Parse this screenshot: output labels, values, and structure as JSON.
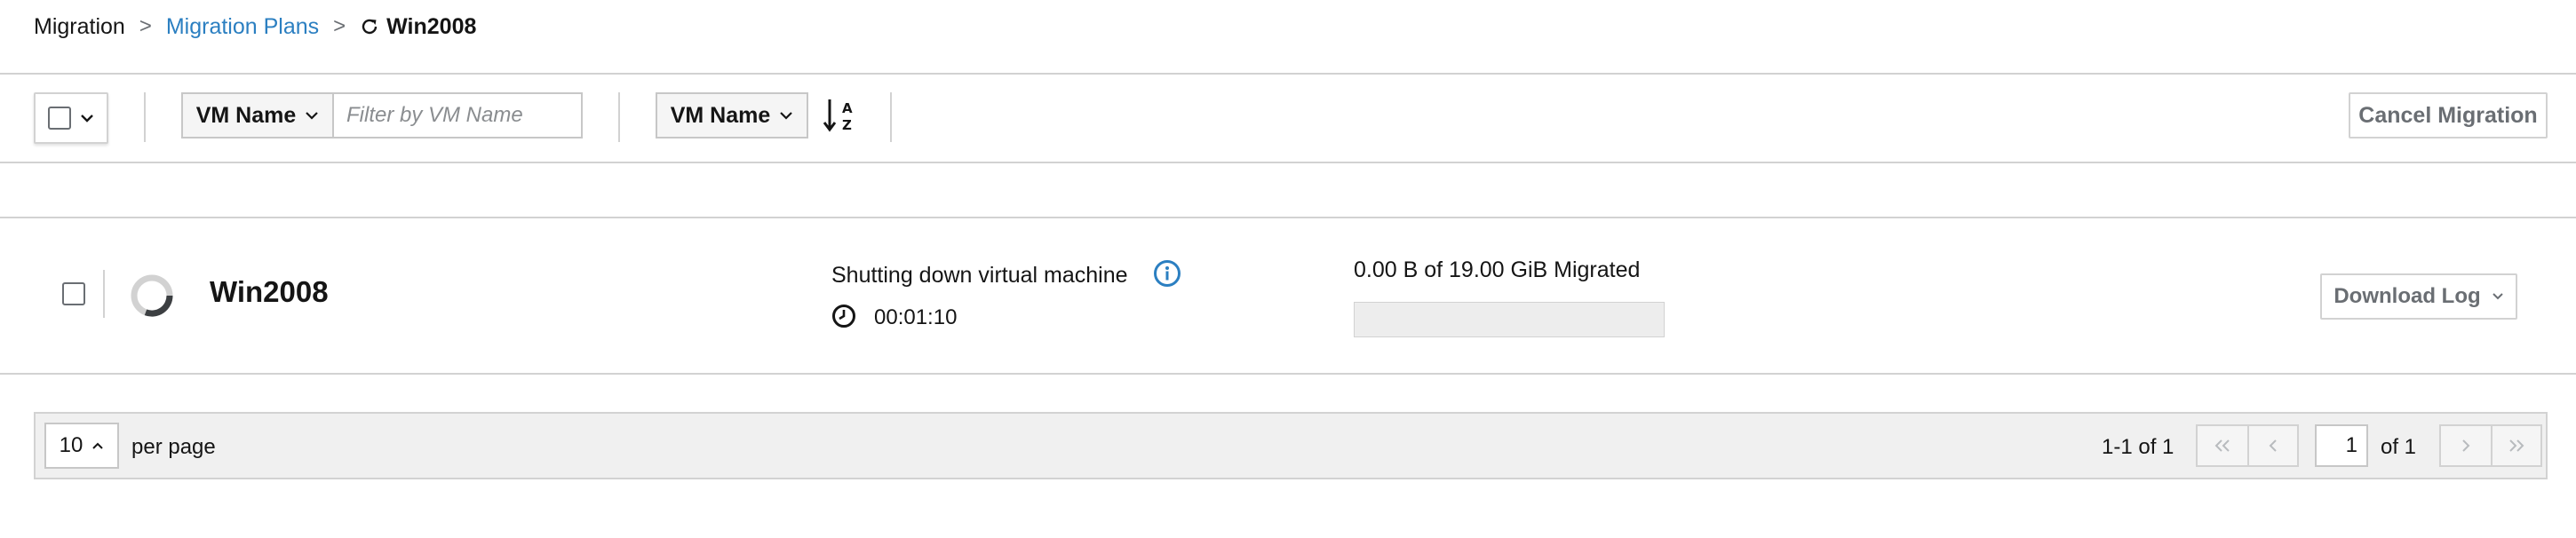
{
  "breadcrumb": {
    "root": "Migration",
    "plans": "Migration Plans",
    "current": "Win2008",
    "separator": ">"
  },
  "toolbar": {
    "filter_field": "VM Name",
    "filter_placeholder": "Filter by VM Name",
    "sort_field": "VM Name",
    "cancel_label": "Cancel Migration"
  },
  "vm_row": {
    "name": "Win2008",
    "status": "Shutting down virtual machine",
    "elapsed": "00:01:10",
    "progress_text": "0.00 B of 19.00 GiB Migrated",
    "progress_fraction": 0.0,
    "download_label": "Download Log"
  },
  "pagination": {
    "per_page_value": "10",
    "per_page_label": "per page",
    "range": "1-1 of 1",
    "current_page": "1",
    "total_pages_label": "of 1"
  },
  "colors": {
    "link": "#2b7fc1",
    "info": "#2b7fc1",
    "border": "#d2d2d2",
    "muted_text": "#6a6e73"
  },
  "icons": [
    "refresh-icon",
    "chevron-down-icon",
    "sort-alpha-asc-icon",
    "spinner-icon",
    "info-circle-icon",
    "clock-icon",
    "angle-double-left-icon",
    "angle-left-icon",
    "angle-right-icon",
    "angle-double-right-icon",
    "caret-up-icon"
  ]
}
